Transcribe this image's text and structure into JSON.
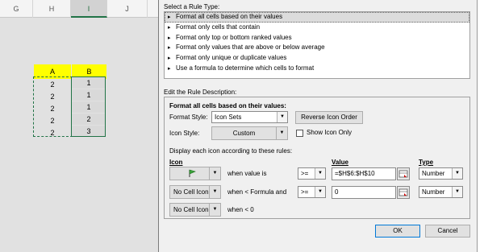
{
  "sheet": {
    "columns": [
      "G",
      "H",
      "I",
      "J"
    ],
    "selected_column": "I",
    "table_headers": [
      "A",
      "B"
    ],
    "col_a_values": [
      "2",
      "2",
      "2",
      "2",
      "2"
    ],
    "col_b_values": [
      "1",
      "1",
      "1",
      "2",
      "3"
    ],
    "header_fill": "#ffff00",
    "selection_color": "#217346"
  },
  "dialog": {
    "select_rule_type_label": "Select a Rule Type:",
    "rule_types": [
      "Format all cells based on their values",
      "Format only cells that contain",
      "Format only top or bottom ranked values",
      "Format only values that are above or below average",
      "Format only unique or duplicate values",
      "Use a formula to determine which cells to format"
    ],
    "selected_rule_index": 0,
    "edit_description_label": "Edit the Rule Description:",
    "format_all_label": "Format all cells based on their values:",
    "format_style_label": "Format Style:",
    "format_style_value": "Icon Sets",
    "reverse_icon_order_label": "Reverse Icon Order",
    "icon_style_label": "Icon Style:",
    "icon_style_value": "Custom",
    "show_icon_only_label": "Show Icon Only",
    "show_icon_only_checked": false,
    "display_rules_label": "Display each icon according to these rules:",
    "col_icon": "Icon",
    "col_value": "Value",
    "col_type": "Type",
    "rows": [
      {
        "icon": "",
        "icon_name": "green-flag-icon",
        "condition": "when value is",
        "operator": ">=",
        "value": "=$H$6:$H$10",
        "type": "Number"
      },
      {
        "icon": "No Cell Icon",
        "icon_name": "",
        "condition": "when < Formula and",
        "operator": ">=",
        "value": "0",
        "type": "Number"
      },
      {
        "icon": "No Cell Icon",
        "icon_name": "",
        "condition": "when < 0",
        "operator": "",
        "value": "",
        "type": ""
      }
    ],
    "ok_label": "OK",
    "cancel_label": "Cancel"
  }
}
